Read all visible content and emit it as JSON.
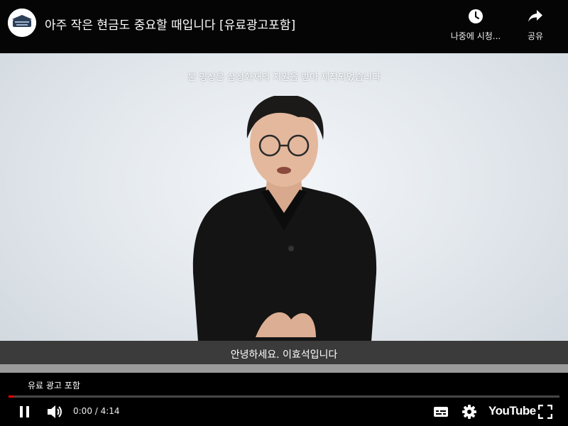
{
  "header": {
    "title": "아주 작은 현금도 중요할 때입니다 [유료광고포함]",
    "channel_avatar_icon": "channel-logo-icon",
    "watch_later": {
      "label": "나중에 시청...",
      "icon": "clock-icon"
    },
    "share": {
      "label": "공유",
      "icon": "share-arrow-icon"
    }
  },
  "video": {
    "top_caption": "본 영상은 삼성화재의 지원을 받아 제작되었습니다",
    "subtitle": "안녕하세요. 이효석입니다"
  },
  "player": {
    "paid_promotion": "유료 광고 포함",
    "time": "0:00 / 4:14",
    "progress": 0.01,
    "logo_text": "YouTube",
    "progress_color": "#ff0000",
    "icons": [
      "pause-icon",
      "volume-icon",
      "subtitles-icon",
      "settings-gear-icon",
      "fullscreen-icon"
    ]
  }
}
